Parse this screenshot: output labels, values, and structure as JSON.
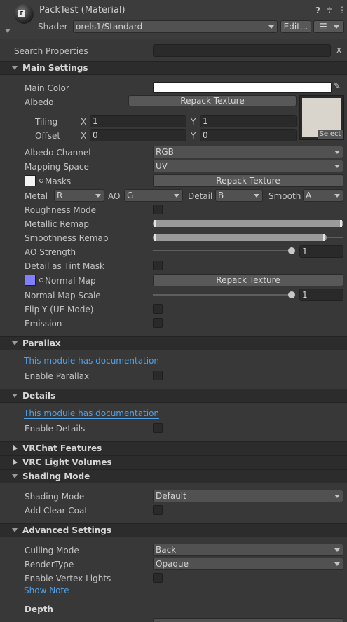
{
  "header": {
    "title": "PackTest (Material)",
    "shader_label": "Shader",
    "shader_value": "orels1/Standard",
    "edit_label": "Edit...",
    "help_glyph": "?",
    "settings_glyph": "≑",
    "more_glyph": "⋮",
    "list_glyph": "☰",
    "material_icon_text": "F"
  },
  "search": {
    "label": "Search Properties",
    "value": "",
    "clear": "x"
  },
  "main_settings": {
    "title": "Main Settings",
    "main_color_label": "Main Color",
    "main_color": "#ffffff",
    "albedo_label": "Albedo",
    "repack_label": "Repack Texture",
    "select_label": "Select",
    "tiling_label": "Tiling",
    "offset_label": "Offset",
    "x_label": "X",
    "y_label": "Y",
    "tiling_x": "1",
    "tiling_y": "1",
    "offset_x": "0",
    "offset_y": "0",
    "albedo_channel_label": "Albedo Channel",
    "albedo_channel_value": "RGB",
    "mapping_space_label": "Mapping Space",
    "mapping_space_value": "UV",
    "masks_label": "Masks",
    "masks_repack": "Repack Texture",
    "metal_label": "Metal",
    "metal_value": "R",
    "ao_label": "AO",
    "ao_value": "G",
    "detail_label": "Detail",
    "detail_value": "B",
    "smooth_label": "Smooth",
    "smooth_value": "A",
    "roughness_mode_label": "Roughness Mode",
    "metallic_remap_label": "Metallic Remap",
    "smoothness_remap_label": "Smoothness Remap",
    "ao_strength_label": "AO Strength",
    "ao_strength_value": "1",
    "detail_tint_label": "Detail as Tint Mask",
    "normal_map_label": "Normal Map",
    "normal_repack": "Repack Texture",
    "normal_color": "#8080ff",
    "normal_scale_label": "Normal Map Scale",
    "normal_scale_value": "1",
    "flip_y_label": "Flip Y (UE Mode)",
    "emission_label": "Emission"
  },
  "parallax": {
    "title": "Parallax",
    "doc_link": "This module has documentation",
    "enable_label": "Enable Parallax"
  },
  "details": {
    "title": "Details",
    "doc_link": "This module has documentation",
    "enable_label": "Enable Details"
  },
  "vrchat": {
    "title": "VRChat Features"
  },
  "vrc_light": {
    "title": "VRC Light Volumes"
  },
  "shading": {
    "title": "Shading Mode",
    "mode_label": "Shading Mode",
    "mode_value": "Default",
    "clear_coat_label": "Add Clear Coat"
  },
  "advanced": {
    "title": "Advanced Settings",
    "culling_label": "Culling Mode",
    "culling_value": "Back",
    "render_type_label": "RenderType",
    "render_type_value": "Opaque",
    "vertex_lights_label": "Enable Vertex Lights",
    "show_note": "Show Note",
    "depth_label": "Depth"
  },
  "colors": {
    "background": "#383838",
    "section_band": "#2c2c2c",
    "link": "#4ea1e8",
    "field": "#2a2a2a",
    "button": "#585858"
  }
}
